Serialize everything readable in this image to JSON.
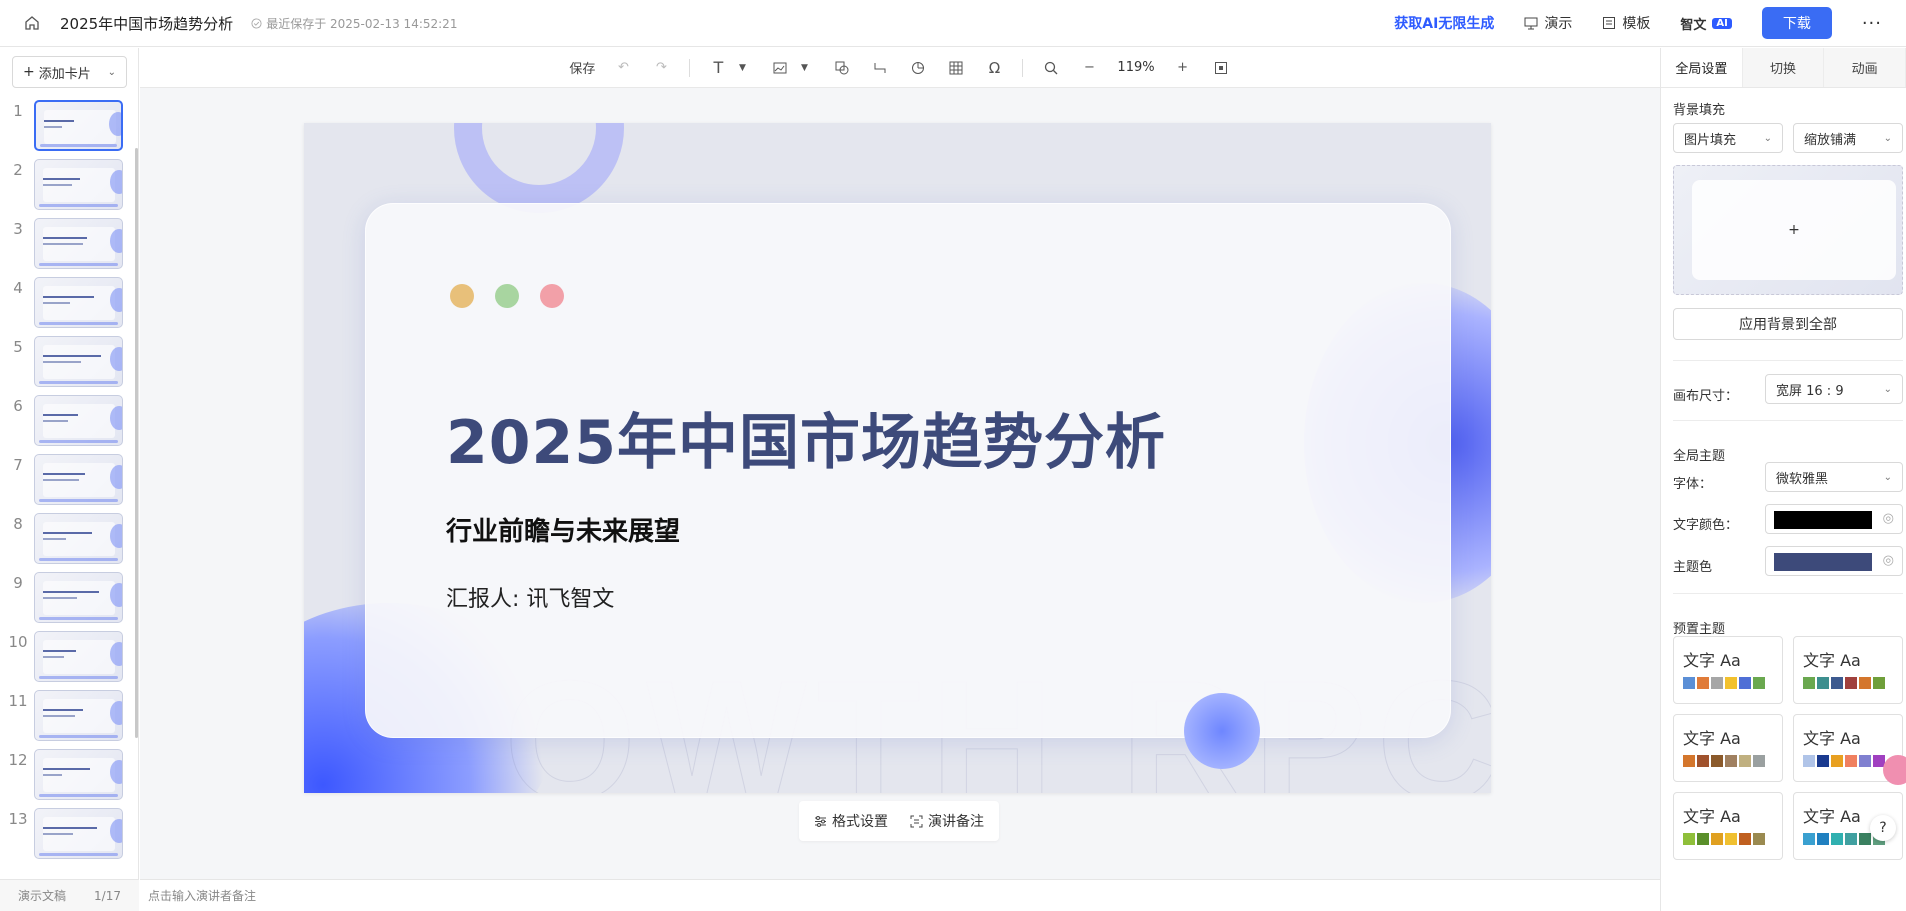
{
  "topbar": {
    "doc_title": "2025年中国市场趋势分析",
    "saved_text": "最近保存于 2025-02-13 14:52:21",
    "ai_promo": "获取AI无限生成",
    "present_label": "演示",
    "template_label": "模板",
    "zhiwen_label": "智文",
    "ai_badge": "AI",
    "download_label": "下载",
    "more_label": "···"
  },
  "left": {
    "add_card_label": "添加卡片",
    "thumbnails": [
      "1",
      "2",
      "3",
      "4",
      "5",
      "6",
      "7",
      "8",
      "9",
      "10",
      "11",
      "12",
      "13"
    ],
    "active_index": 1,
    "footer_doc": "演示文稿",
    "footer_page": "1/17"
  },
  "toolbar": {
    "save_label": "保存",
    "zoom_value": "119%"
  },
  "slide": {
    "title": "2025年中国市场趋势分析",
    "subtitle": "行业前瞻与未来展望",
    "reporter": "汇报人: 讯飞智文",
    "dot_colors": [
      "#e8c07a",
      "#a8d5a0",
      "#f2a0a8"
    ]
  },
  "bottom_bar": {
    "format_label": "格式设置",
    "notes_label": "演讲备注"
  },
  "notes": {
    "placeholder": "点击输入演讲者备注"
  },
  "right": {
    "tabs": [
      "全局设置",
      "切换",
      "动画"
    ],
    "bg_fill_label": "背景填充",
    "fill_type": "图片填充",
    "fill_mode": "缩放铺满",
    "preview_plus": "+",
    "apply_bg_label": "应用背景到全部",
    "canvas_size_label": "画布尺寸：",
    "canvas_size_value": "宽屏 16 : 9",
    "global_theme_label": "全局主题",
    "font_label": "字体：",
    "font_value": "微软雅黑",
    "text_color_label": "文字颜色：",
    "text_color": "#000000",
    "theme_color_label": "主题色",
    "theme_color": "#3d4a7a",
    "preset_theme_label": "预置主题",
    "theme_cards": [
      {
        "title": "文字 Aa",
        "palette": [
          "#5b8fd6",
          "#e07b39",
          "#a6a6a6",
          "#f2c12e",
          "#4f6fd6",
          "#6aa84f"
        ]
      },
      {
        "title": "文字 Aa",
        "palette": [
          "#6aa84f",
          "#3d8f8f",
          "#3d5a8f",
          "#a0403d",
          "#d4762c",
          "#6f9f3a"
        ]
      },
      {
        "title": "文字 Aa",
        "palette": [
          "#d4762c",
          "#a0522d",
          "#8b5a2b",
          "#a08060",
          "#c0b080",
          "#9aa0a0"
        ]
      },
      {
        "title": "文字 Aa",
        "palette": [
          "#b0c4e8",
          "#1a3a8f",
          "#e8a020",
          "#f08060",
          "#8080d0",
          "#a040c0"
        ]
      },
      {
        "title": "文字 Aa",
        "palette": [
          "#8fbf3a",
          "#5a8f2a",
          "#e0a020",
          "#f0c030",
          "#c06020",
          "#9a8a50"
        ]
      },
      {
        "title": "文字 Aa",
        "palette": [
          "#3aa0d0",
          "#2080c0",
          "#30b0b0",
          "#40a0a0",
          "#3a8060",
          "#60a080"
        ]
      }
    ],
    "help_label": "?"
  }
}
